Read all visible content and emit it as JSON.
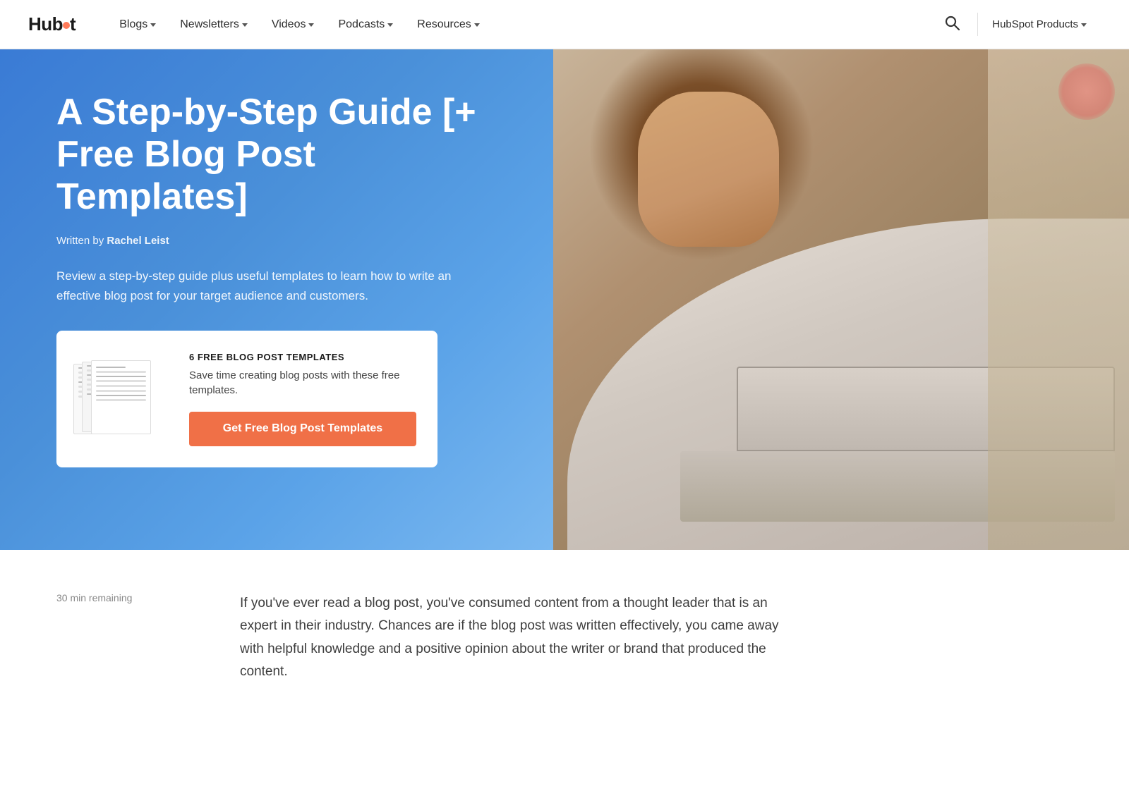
{
  "nav": {
    "logo_text": "HubSpot",
    "links": [
      {
        "label": "Blogs",
        "id": "blogs"
      },
      {
        "label": "Newsletters",
        "id": "newsletters"
      },
      {
        "label": "Videos",
        "id": "videos"
      },
      {
        "label": "Podcasts",
        "id": "podcasts"
      },
      {
        "label": "Resources",
        "id": "resources"
      }
    ],
    "cta_label": "HubSpot Products"
  },
  "hero": {
    "title": "A Step-by-Step Guide [+ Free Blog Post Templates]",
    "author_prefix": "Written by ",
    "author_name": "Rachel Leist",
    "description": "Review a step-by-step guide plus useful templates to learn how to write an effective blog post for your target audience and customers.",
    "cta_card": {
      "badge": "6 FREE BLOG POST TEMPLATES",
      "description": "Save time creating blog posts with these free templates.",
      "button_label": "Get Free Blog Post Templates"
    }
  },
  "article": {
    "reading_time": "30 min remaining",
    "intro": "If you've ever read a blog post, you've consumed content from a thought leader that is an expert in their industry. Chances are if the blog post was written effectively, you came away with helpful knowledge and a positive opinion about the writer or brand that produced the content."
  }
}
